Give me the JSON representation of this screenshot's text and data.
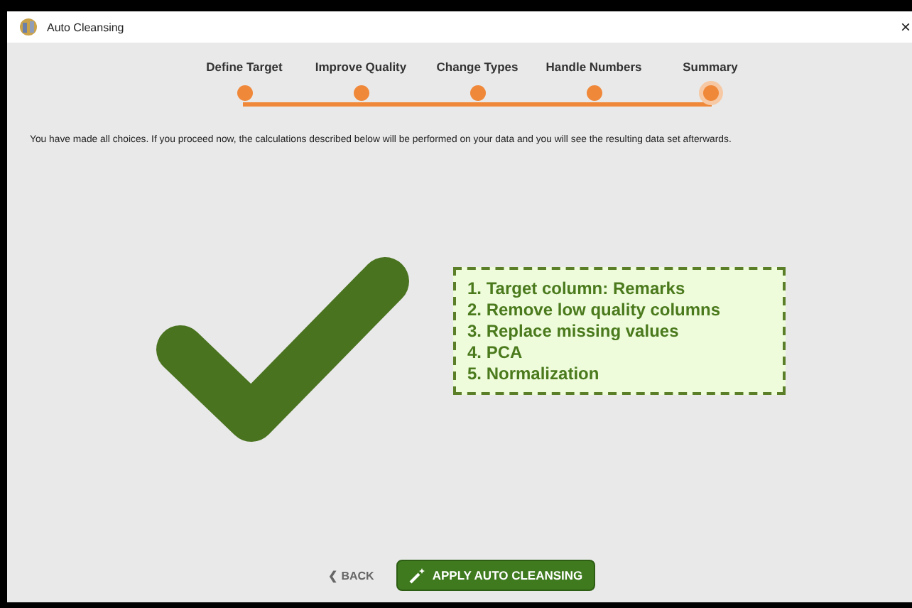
{
  "window": {
    "title": "Auto Cleansing",
    "close": "×"
  },
  "steps": [
    {
      "label": "Define Target",
      "selected": false
    },
    {
      "label": "Improve Quality",
      "selected": false
    },
    {
      "label": "Change Types",
      "selected": false
    },
    {
      "label": "Handle Numbers",
      "selected": false
    },
    {
      "label": "Summary",
      "selected": true
    }
  ],
  "message": "You have made all choices. If you proceed now, the calculations described below will be performed on your data and you will see the resulting data set afterwards.",
  "summary": [
    "1. Target column: Remarks",
    "2. Remove low quality columns",
    "3. Replace missing values",
    "4. PCA",
    "5. Normalization"
  ],
  "buttons": [
    {
      "kind": "back",
      "label": "BACK",
      "icon": "❮"
    },
    {
      "kind": "primary",
      "label": "APPLY AUTO CLEANSING"
    }
  ]
}
